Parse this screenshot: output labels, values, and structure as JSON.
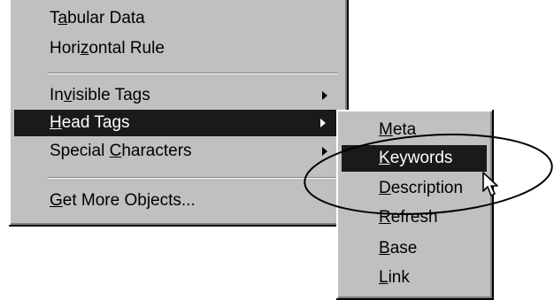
{
  "main_menu": {
    "items": [
      {
        "pre": "T",
        "ul": "a",
        "post": "bular Data"
      },
      {
        "pre": "Hori",
        "ul": "z",
        "post": "ontal Rule"
      },
      {
        "pre": "In",
        "ul": "v",
        "post": "isible Tags"
      },
      {
        "pre": "",
        "ul": "H",
        "post": "ead Tags"
      },
      {
        "pre": "Special ",
        "ul": "C",
        "post": "haracters"
      },
      {
        "pre": "",
        "ul": "G",
        "post": "et More Objects..."
      }
    ]
  },
  "sub_menu": {
    "items": [
      {
        "pre": "",
        "ul": "M",
        "post": "eta"
      },
      {
        "pre": "",
        "ul": "K",
        "post": "eywords"
      },
      {
        "pre": "",
        "ul": "D",
        "post": "escription"
      },
      {
        "pre": "",
        "ul": "R",
        "post": "efresh"
      },
      {
        "pre": "",
        "ul": "B",
        "post": "ase"
      },
      {
        "pre": "",
        "ul": "L",
        "post": "ink"
      }
    ]
  },
  "icons": {
    "submenu_arrow": "triangle-right",
    "cursor": "arrow-pointer"
  },
  "colors": {
    "menu_bg": "#c0c0c0",
    "highlight_bg": "#1a1a1a",
    "highlight_text": "#ffffff"
  }
}
